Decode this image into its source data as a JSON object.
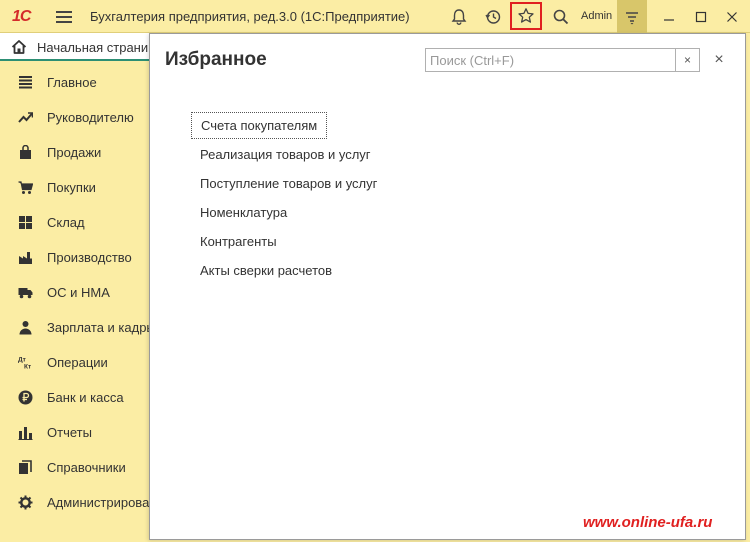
{
  "titlebar": {
    "logo": "1С",
    "app_title": "Бухгалтерия предприятия, ред.3.0  (1С:Предприятие)",
    "user": "Admin"
  },
  "home_tab": {
    "label": "Начальная страница"
  },
  "sidebar": {
    "items": [
      {
        "label": "Главное",
        "icon": "menu-lines-icon"
      },
      {
        "label": "Руководителю",
        "icon": "trend-icon"
      },
      {
        "label": "Продажи",
        "icon": "bag-icon"
      },
      {
        "label": "Покупки",
        "icon": "cart-icon"
      },
      {
        "label": "Склад",
        "icon": "warehouse-icon"
      },
      {
        "label": "Производство",
        "icon": "factory-icon"
      },
      {
        "label": "ОС и НМА",
        "icon": "truck-icon"
      },
      {
        "label": "Зарплата и кадры",
        "icon": "person-icon"
      },
      {
        "label": "Операции",
        "icon": "dt-kt-icon"
      },
      {
        "label": "Банк и касса",
        "icon": "ruble-icon"
      },
      {
        "label": "Отчеты",
        "icon": "bar-chart-icon"
      },
      {
        "label": "Справочники",
        "icon": "books-icon"
      },
      {
        "label": "Администрирование",
        "icon": "gear-icon"
      }
    ],
    "operations_icon_text": {
      "top": "Дт",
      "bottom": "Кт"
    }
  },
  "panel": {
    "title": "Избранное",
    "search_placeholder": "Поиск (Ctrl+F)",
    "clear_symbol": "×",
    "close_symbol": "×",
    "items": [
      {
        "label": "Счета покупателям"
      },
      {
        "label": "Реализация товаров и услуг"
      },
      {
        "label": "Поступление товаров и услуг"
      },
      {
        "label": "Номенклатура"
      },
      {
        "label": "Контрагенты"
      },
      {
        "label": "Акты сверки расчетов"
      }
    ]
  },
  "watermark": "www.online-ufa.ru",
  "colors": {
    "accent": "#fbeda4",
    "highlight": "#e02020",
    "tab_underline": "#2d8f74"
  }
}
